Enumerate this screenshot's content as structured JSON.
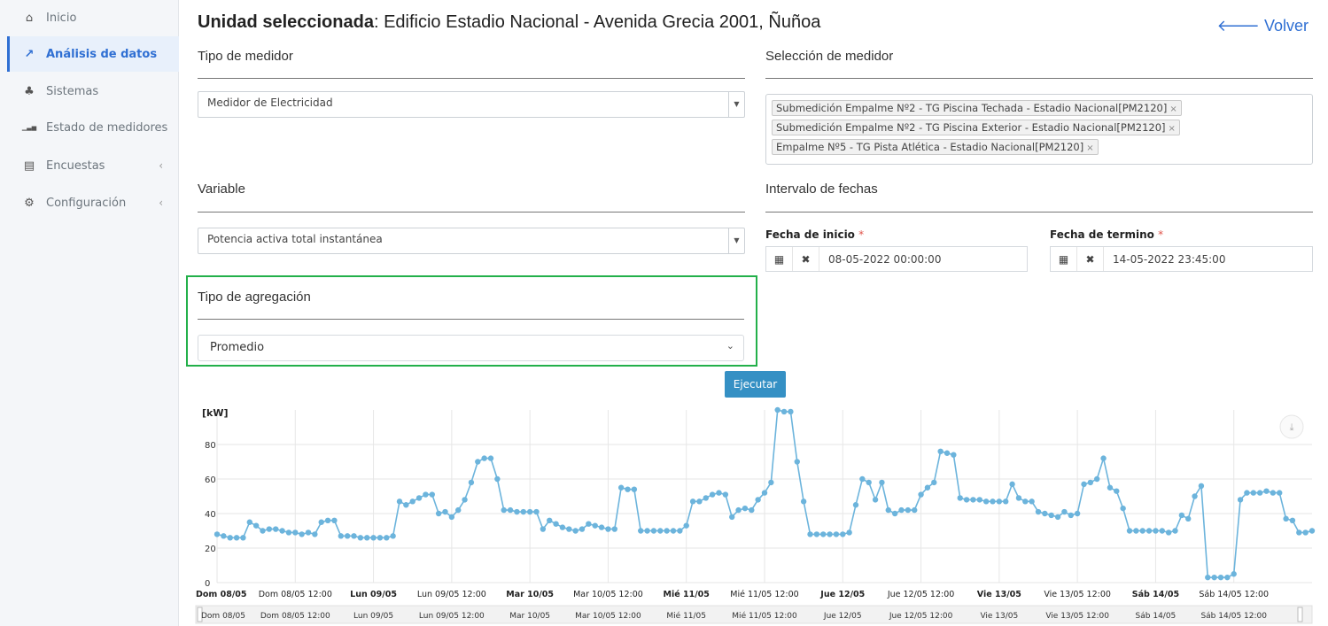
{
  "sidebar": {
    "items": [
      {
        "label": "Inicio",
        "icon": "home-icon",
        "glyph": "⌂",
        "active": false,
        "submenu": false
      },
      {
        "label": "Análisis de datos",
        "icon": "chart-line-icon",
        "glyph": "↗",
        "active": true,
        "submenu": false
      },
      {
        "label": "Sistemas",
        "icon": "sitemap-icon",
        "glyph": "♣",
        "active": false,
        "submenu": false
      },
      {
        "label": "Estado de medidores",
        "icon": "signal-bars-icon",
        "glyph": "▁▃▅",
        "active": false,
        "submenu": false
      },
      {
        "label": "Encuestas",
        "icon": "clipboard-icon",
        "glyph": "▤",
        "active": false,
        "submenu": true
      },
      {
        "label": "Configuración",
        "icon": "gear-icon",
        "glyph": "⚙",
        "active": false,
        "submenu": true
      }
    ],
    "chevron": "‹"
  },
  "header": {
    "title_bold": "Unidad seleccionada",
    "title_rest": ": Edificio Estadio Nacional - Avenida Grecia 2001, Ñuñoa",
    "back_label": "Volver",
    "back_glyph": "🡐"
  },
  "form": {
    "meter_type_label": "Tipo de medidor",
    "meter_type_value": "Medidor de Electricidad",
    "meter_selection_label": "Selección de medidor",
    "meters": [
      "Submedición Empalme Nº2 - TG Piscina Techada - Estadio Nacional[PM2120]",
      "Submedición Empalme Nº2 - TG Piscina Exterior - Estadio Nacional[PM2120]",
      "Empalme Nº5 - TG Pista Atlética - Estadio Nacional[PM2120]"
    ],
    "variable_label": "Variable",
    "variable_value": "Potencia activa total instantánea",
    "date_range_label": "Intervalo de fechas",
    "start_label": "Fecha de inicio",
    "start_value": "08-05-2022 00:00:00",
    "end_label": "Fecha de termino",
    "end_value": "14-05-2022 23:45:00",
    "required_mark": "*",
    "aggregation_label": "Tipo de agregación",
    "aggregation_value": "Promedio",
    "run_label": "Ejecutar"
  },
  "chart_data": {
    "type": "line",
    "ylabel": "[kW]",
    "y_ticks": [
      0,
      20,
      40,
      60,
      80
    ],
    "ylim": [
      0,
      100
    ],
    "xlim": [
      0,
      168
    ],
    "x_ticks": [
      {
        "at": 0,
        "label": "Dom 08/05",
        "bold": true
      },
      {
        "at": 12,
        "label": "Dom 08/05 12:00",
        "bold": false
      },
      {
        "at": 24,
        "label": "Lun 09/05",
        "bold": true
      },
      {
        "at": 36,
        "label": "Lun 09/05 12:00",
        "bold": false
      },
      {
        "at": 48,
        "label": "Mar 10/05",
        "bold": true
      },
      {
        "at": 60,
        "label": "Mar 10/05 12:00",
        "bold": false
      },
      {
        "at": 72,
        "label": "Mié 11/05",
        "bold": true
      },
      {
        "at": 84,
        "label": "Mié 11/05 12:00",
        "bold": false
      },
      {
        "at": 96,
        "label": "Jue 12/05",
        "bold": true
      },
      {
        "at": 108,
        "label": "Jue 12/05 12:00",
        "bold": false
      },
      {
        "at": 120,
        "label": "Vie 13/05",
        "bold": true
      },
      {
        "at": 132,
        "label": "Vie 13/05 12:00",
        "bold": false
      },
      {
        "at": 144,
        "label": "Sáb 14/05",
        "bold": true
      },
      {
        "at": 156,
        "label": "Sáb 14/05 12:00",
        "bold": false
      }
    ],
    "navigator_labels": [
      "Dom 08/05",
      "Dom 08/05 12:00",
      "Lun 09/05",
      "Lun 09/05 12:00",
      "Mar 10/05",
      "Mar 10/05 12:00",
      "Mié 11/05",
      "Mié 11/05 12:00",
      "Jue 12/05",
      "Jue 12/05 12:00",
      "Vie 13/05",
      "Vie 13/05 12:00",
      "Sáb 14/05",
      "Sáb 14/05 12:00"
    ],
    "series": [
      {
        "color": "#6cb4dc",
        "x": [
          0,
          1,
          2,
          3,
          4,
          5,
          6,
          7,
          8,
          9,
          10,
          11,
          12,
          13,
          14,
          15,
          16,
          17,
          18,
          19,
          20,
          21,
          22,
          23,
          24,
          25,
          26,
          27,
          28,
          29,
          30,
          31,
          32,
          33,
          34,
          35,
          36,
          37,
          38,
          39,
          40,
          41,
          42,
          43,
          44,
          45,
          46,
          47,
          48,
          49,
          50,
          51,
          52,
          53,
          54,
          55,
          56,
          57,
          58,
          59,
          60,
          61,
          62,
          63,
          64,
          65,
          66,
          67,
          68,
          69,
          70,
          71,
          72,
          73,
          74,
          75,
          76,
          77,
          78,
          79,
          80,
          81,
          82,
          83,
          84,
          85,
          86,
          87,
          88,
          89,
          90,
          91,
          92,
          93,
          94,
          95,
          96,
          97,
          98,
          99,
          100,
          101,
          102,
          103,
          104,
          105,
          106,
          107,
          108,
          109,
          110,
          111,
          112,
          113,
          114,
          115,
          116,
          117,
          118,
          119,
          120,
          121,
          122,
          123,
          124,
          125,
          126,
          127,
          128,
          129,
          130,
          131,
          132,
          133,
          134,
          135,
          136,
          137,
          138,
          139,
          140,
          141,
          142,
          143,
          144,
          145,
          146,
          147,
          148,
          149,
          150,
          151,
          152,
          153,
          154,
          155,
          156,
          157,
          158,
          159,
          160,
          161,
          162,
          163,
          164,
          165,
          166,
          167,
          168
        ],
        "values": [
          28,
          27,
          26,
          26,
          26,
          35,
          33,
          30,
          31,
          31,
          30,
          29,
          29,
          28,
          29,
          28,
          35,
          36,
          36,
          27,
          27,
          27,
          26,
          26,
          26,
          26,
          26,
          27,
          47,
          45,
          47,
          49,
          51,
          51,
          40,
          41,
          38,
          42,
          48,
          58,
          70,
          72,
          72,
          60,
          42,
          42,
          41,
          41,
          41,
          41,
          31,
          36,
          34,
          32,
          31,
          30,
          31,
          34,
          33,
          32,
          31,
          31,
          55,
          54,
          54,
          30,
          30,
          30,
          30,
          30,
          30,
          30,
          33,
          47,
          47,
          49,
          51,
          52,
          51,
          38,
          42,
          43,
          42,
          48,
          52,
          58,
          100,
          99,
          99,
          70,
          47,
          28,
          28,
          28,
          28,
          28,
          28,
          29,
          45,
          60,
          58,
          48,
          58,
          42,
          40,
          42,
          42,
          42,
          51,
          55,
          58,
          76,
          75,
          74,
          49,
          48,
          48,
          48,
          47,
          47,
          47,
          47,
          57,
          49,
          47,
          47,
          41,
          40,
          39,
          38,
          41,
          39,
          40,
          57,
          58,
          60,
          72,
          55,
          53,
          43,
          30,
          30,
          30,
          30,
          30,
          30,
          29,
          30,
          39,
          37,
          50,
          56,
          3,
          3,
          3,
          3,
          5,
          48,
          52,
          52,
          52,
          53,
          52,
          52,
          37,
          36,
          29,
          29,
          30
        ]
      }
    ]
  }
}
